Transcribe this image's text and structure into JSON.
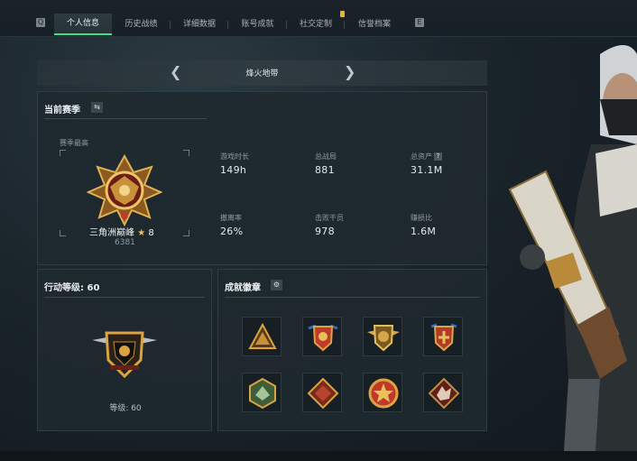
{
  "tabs": [
    {
      "label": "个人信息",
      "active": true
    },
    {
      "label": "历史战绩",
      "active": false
    },
    {
      "label": "详细数据",
      "active": false
    },
    {
      "label": "账号成就",
      "active": false
    },
    {
      "label": "社交定制",
      "active": false
    },
    {
      "label": "信誉档案",
      "active": false
    }
  ],
  "nav": {
    "prev_key": "Q",
    "next_key": "E"
  },
  "season_selector": {
    "title": "烽火地带"
  },
  "current_season": {
    "title": "当前赛季",
    "peak_label": "赛季最高",
    "rank_name": "三角洲巅峰",
    "rank_stars": "8",
    "rank_points": "6381",
    "stats": [
      {
        "label": "游戏时长",
        "value": "149h"
      },
      {
        "label": "总战局",
        "value": "881"
      },
      {
        "label": "总资产",
        "value": "31.1M",
        "help": "?"
      },
      {
        "label": "撤离率",
        "value": "26%"
      },
      {
        "label": "击败干员",
        "value": "978"
      },
      {
        "label": "赚损比",
        "value": "1.6M"
      }
    ]
  },
  "action_level": {
    "title": "行动等级: 60",
    "level_text": "等级: 60"
  },
  "achievements": {
    "title": "成就徽章",
    "badges": [
      {
        "name": "triangle-badge",
        "color": "#c9913a"
      },
      {
        "name": "eagle-shield-badge",
        "color": "#c0392b"
      },
      {
        "name": "wing-shield-badge",
        "color": "#d4a84a"
      },
      {
        "name": "cross-shield-badge",
        "color": "#b33a2a"
      },
      {
        "name": "green-hex-badge",
        "color": "#5e8a55"
      },
      {
        "name": "red-diamond-badge",
        "color": "#b8442f"
      },
      {
        "name": "star-emblem-badge",
        "color": "#c0392b"
      },
      {
        "name": "red-wolf-badge",
        "color": "#a63a2c"
      }
    ]
  },
  "colors": {
    "accent": "#3ee08a",
    "gold": "#d9a441",
    "panel": "#1e292f"
  }
}
